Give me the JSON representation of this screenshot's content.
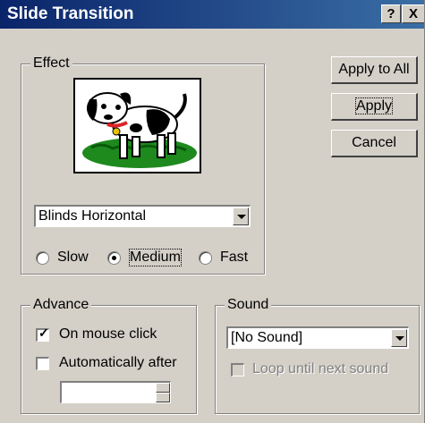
{
  "window": {
    "title": "Slide Transition",
    "help_glyph": "?",
    "close_glyph": "X"
  },
  "effect": {
    "legend": "Effect",
    "preview_icon": "dog-picture",
    "transition": "Blinds Horizontal",
    "speed_options": [
      {
        "label": "Slow",
        "selected": false
      },
      {
        "label": "Medium",
        "selected": true
      },
      {
        "label": "Fast",
        "selected": false
      }
    ]
  },
  "buttons": {
    "apply_all": "Apply to All",
    "apply": "Apply",
    "cancel": "Cancel"
  },
  "advance": {
    "legend": "Advance",
    "on_click": {
      "label": "On mouse click",
      "checked": true
    },
    "auto": {
      "label": "Automatically after",
      "checked": false,
      "value": ""
    }
  },
  "sound": {
    "legend": "Sound",
    "selected": "[No Sound]",
    "loop": {
      "label": "Loop until next sound",
      "checked": false,
      "enabled": false
    }
  }
}
